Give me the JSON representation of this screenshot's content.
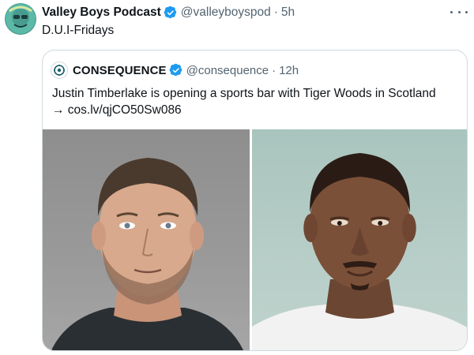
{
  "tweet": {
    "author_name": "Valley Boys Podcast",
    "author_handle": "@valleyboyspod",
    "separator": "·",
    "time": "5h",
    "text": "D.U.I-Fridays",
    "more_icon": "more-horizontal-icon",
    "verified_icon": "verified-badge-icon"
  },
  "quoted_tweet": {
    "author_name": "CONSEQUENCE",
    "author_handle": "@consequence",
    "separator": "·",
    "time": "12h",
    "text_line1": "Justin Timberlake is opening a sports bar with Tiger Woods in Scotland",
    "text_line2": "→ cos.lv/qjCO50Sw086",
    "verified_icon": "verified-badge-icon"
  },
  "media": {
    "photos": [
      {
        "subject": "mugshot-left"
      },
      {
        "subject": "mugshot-right"
      }
    ]
  },
  "colors": {
    "verified": "#1d9bf0",
    "secondary_text": "#536471",
    "border": "#cfd9de"
  }
}
